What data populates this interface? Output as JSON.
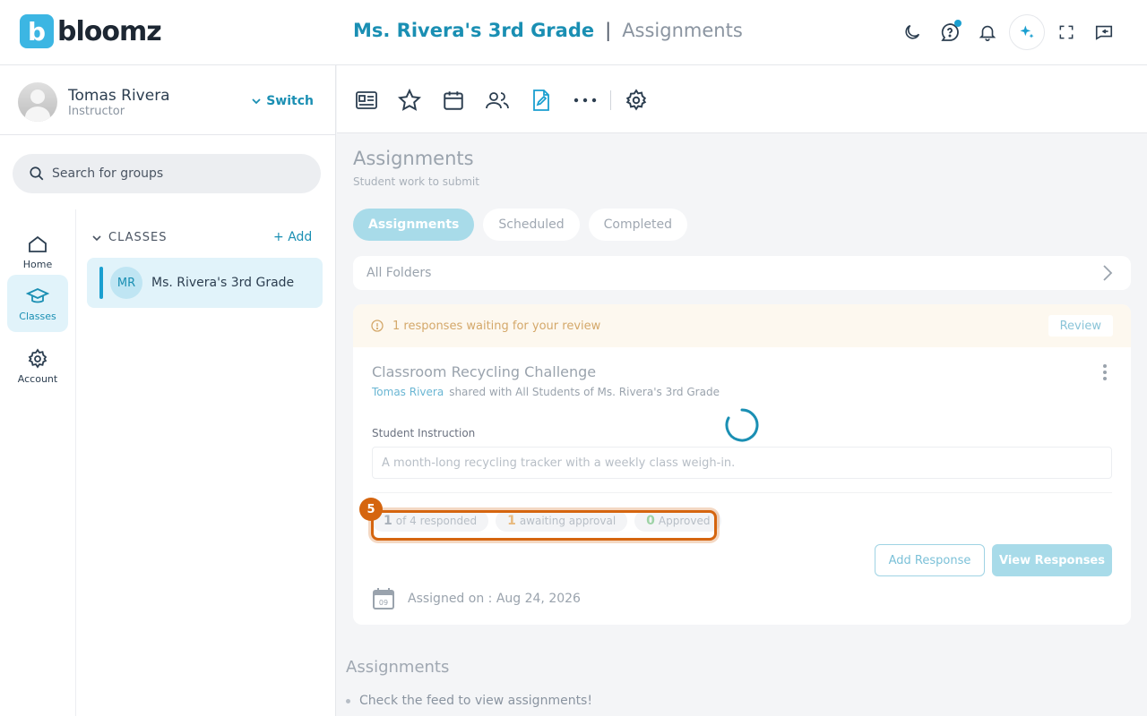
{
  "brand": {
    "logo_letter": "b",
    "logo_text": "bloomz",
    "color": "#3cb6e3"
  },
  "header": {
    "group": "Ms. Rivera's 3rd Grade",
    "separator": "|",
    "page": "Assignments",
    "icons": [
      "moon-icon",
      "help-chat-icon",
      "bell-icon",
      "ai-sparkle-icon",
      "fullscreen-icon",
      "collapse-panel-icon"
    ]
  },
  "profile": {
    "name": "Tomas Rivera",
    "role": "Instructor",
    "switch_label": "Switch"
  },
  "search": {
    "placeholder": "Search for groups"
  },
  "nav": {
    "home": "Home",
    "classes": "Classes",
    "account": "Account"
  },
  "classes": {
    "header": "CLASSES",
    "add_label": "Add",
    "items": [
      {
        "initials": "MR",
        "name": "Ms. Rivera's 3rd Grade"
      }
    ]
  },
  "toolbar": {
    "icons": [
      "id-card-icon",
      "star-icon",
      "calendar-icon",
      "people-icon",
      "assignment-icon",
      "more-icon",
      "settings-icon"
    ],
    "active": "assignment-icon"
  },
  "main": {
    "title": "Assignments",
    "subtitle": "Student work to submit",
    "tabs": [
      "Assignments",
      "Scheduled",
      "Completed"
    ],
    "active_tab": "Assignments",
    "folders_label": "All Folders"
  },
  "assignment": {
    "notice": "1 responses waiting for your review",
    "review_label": "Review",
    "title": "Classroom Recycling Challenge",
    "author": "Tomas Rivera",
    "shared_with": "shared with All Students of Ms. Rivera's 3rd Grade",
    "instruction_label": "Student Instruction",
    "instruction": "A month-long recycling tracker with a weekly class weigh-in.",
    "stats": {
      "responded_n": "1",
      "responded_text": "of 4 responded",
      "awaiting_n": "1",
      "awaiting_text": "awaiting approval",
      "approved_n": "0",
      "approved_text": "Approved"
    },
    "add_response": "Add Response",
    "view_responses": "View Responses",
    "calendar_day": "09",
    "assigned_on": "Assigned on : Aug 24, 2026"
  },
  "step_badge": "5",
  "section": {
    "title": "Assignments",
    "item": "Check the feed to view assignments!"
  }
}
